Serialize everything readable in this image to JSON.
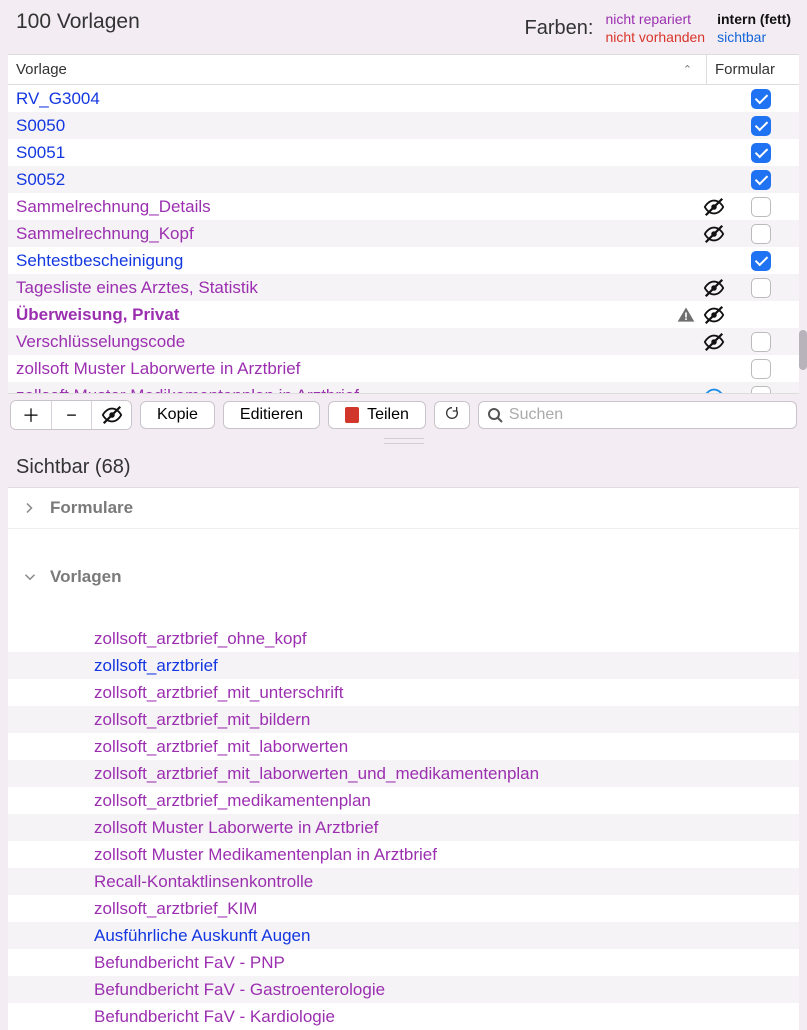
{
  "header": {
    "title": "100 Vorlagen",
    "legend_label": "Farben:",
    "legend": {
      "col1": [
        "nicht repariert",
        "nicht vorhanden"
      ],
      "col2": [
        "intern (fett)",
        "sichtbar"
      ]
    }
  },
  "columns": {
    "vorlage": "Vorlage",
    "formular": "Formular"
  },
  "rows": [
    {
      "name": "RV_G3004",
      "color": "blue",
      "hidden": false,
      "checked": true
    },
    {
      "name": "S0050",
      "color": "blue",
      "hidden": false,
      "checked": true
    },
    {
      "name": "S0051",
      "color": "blue",
      "hidden": false,
      "checked": true
    },
    {
      "name": "S0052",
      "color": "blue",
      "hidden": false,
      "checked": true
    },
    {
      "name": "Sammelrechnung_Details",
      "color": "purple",
      "hidden": true,
      "checked": false
    },
    {
      "name": "Sammelrechnung_Kopf",
      "color": "purple",
      "hidden": true,
      "checked": false
    },
    {
      "name": "Sehtestbescheinigung",
      "color": "blue",
      "hidden": false,
      "checked": true
    },
    {
      "name": "Tagesliste eines Arztes, Statistik",
      "color": "purple",
      "hidden": true,
      "checked": false
    },
    {
      "name": "Überweisung, Privat",
      "color": "purple",
      "bold": true,
      "warn": true,
      "hidden": true,
      "checked": null
    },
    {
      "name": "Verschlüsselungscode",
      "color": "purple",
      "hidden": true,
      "checked": false
    },
    {
      "name": "zollsoft Muster Laborwerte in Arztbrief",
      "color": "purple",
      "hidden": false,
      "checked": false
    },
    {
      "name": "zollsoft Muster Medikamentenplan in Arztbrief",
      "color": "purple",
      "eyeblue": true,
      "checked": false
    }
  ],
  "toolbar": {
    "kopie": "Kopie",
    "editieren": "Editieren",
    "teilen": "Teilen",
    "search_placeholder": "Suchen"
  },
  "visible_section": {
    "title": "Sichtbar (68)",
    "groups": {
      "formulare": "Formulare",
      "vorlagen": "Vorlagen"
    },
    "items": [
      {
        "name": "zollsoft_arztbrief_ohne_kopf",
        "color": "purple"
      },
      {
        "name": "zollsoft_arztbrief",
        "color": "blue"
      },
      {
        "name": "zollsoft_arztbrief_mit_unterschrift",
        "color": "purple"
      },
      {
        "name": "zollsoft_arztbrief_mit_bildern",
        "color": "purple"
      },
      {
        "name": "zollsoft_arztbrief_mit_laborwerten",
        "color": "purple"
      },
      {
        "name": "zollsoft_arztbrief_mit_laborwerten_und_medikamentenplan",
        "color": "purple"
      },
      {
        "name": "zollsoft_arztbrief_medikamentenplan",
        "color": "purple"
      },
      {
        "name": "zollsoft Muster Laborwerte in Arztbrief",
        "color": "purple"
      },
      {
        "name": "zollsoft Muster Medikamentenplan in Arztbrief",
        "color": "purple"
      },
      {
        "name": "Recall-Kontaktlinsenkontrolle",
        "color": "purple"
      },
      {
        "name": "zollsoft_arztbrief_KIM",
        "color": "purple"
      },
      {
        "name": "Ausführliche Auskunft Augen",
        "color": "blue"
      },
      {
        "name": "Befundbericht FaV - PNP",
        "color": "purple"
      },
      {
        "name": "Befundbericht FaV - Gastroenterologie",
        "color": "purple"
      },
      {
        "name": "Befundbericht FaV - Kardiologie",
        "color": "purple"
      }
    ]
  }
}
